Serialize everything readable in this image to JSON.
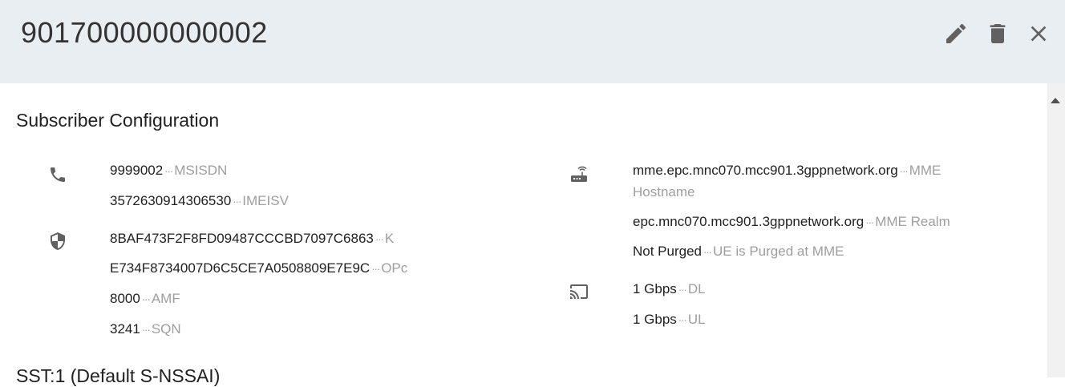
{
  "header": {
    "title": "901700000000002"
  },
  "content": {
    "section_title": "Subscriber Configuration",
    "next_section_title": "SST:1 (Default S-NSSAI)",
    "separator": "···",
    "left": {
      "phone_group": [
        {
          "value": "9999002",
          "label": "MSISDN"
        },
        {
          "value": "3572630914306530",
          "label": "IMEISV"
        }
      ],
      "security_group": [
        {
          "value": "8BAF473F2F8FD09487CCCBD7097C6863",
          "label": "K"
        },
        {
          "value": "E734F8734007D6C5CE7A0508809E7E9C",
          "label": "OPc"
        },
        {
          "value": "8000",
          "label": "AMF"
        },
        {
          "value": "3241",
          "label": "SQN"
        }
      ]
    },
    "right": {
      "mme_group": [
        {
          "value": "mme.epc.mnc070.mcc901.3gppnetwork.org",
          "label": "MME Hostname"
        },
        {
          "value": "epc.mnc070.mcc901.3gppnetwork.org",
          "label": "MME Realm"
        },
        {
          "value": "Not Purged",
          "label": "UE is Purged at MME"
        }
      ],
      "ambr_group": [
        {
          "value": "1 Gbps",
          "label": "DL"
        },
        {
          "value": "1 Gbps",
          "label": "UL"
        }
      ]
    }
  },
  "icons": {
    "edit": "edit-icon",
    "delete": "delete-icon",
    "close": "close-icon",
    "phone": "phone-icon",
    "security": "security-icon",
    "router": "router-icon",
    "cast": "cast-icon"
  },
  "colors": {
    "header_bg": "#e9eef3",
    "icon": "#616161",
    "label": "#9e9e9e"
  }
}
